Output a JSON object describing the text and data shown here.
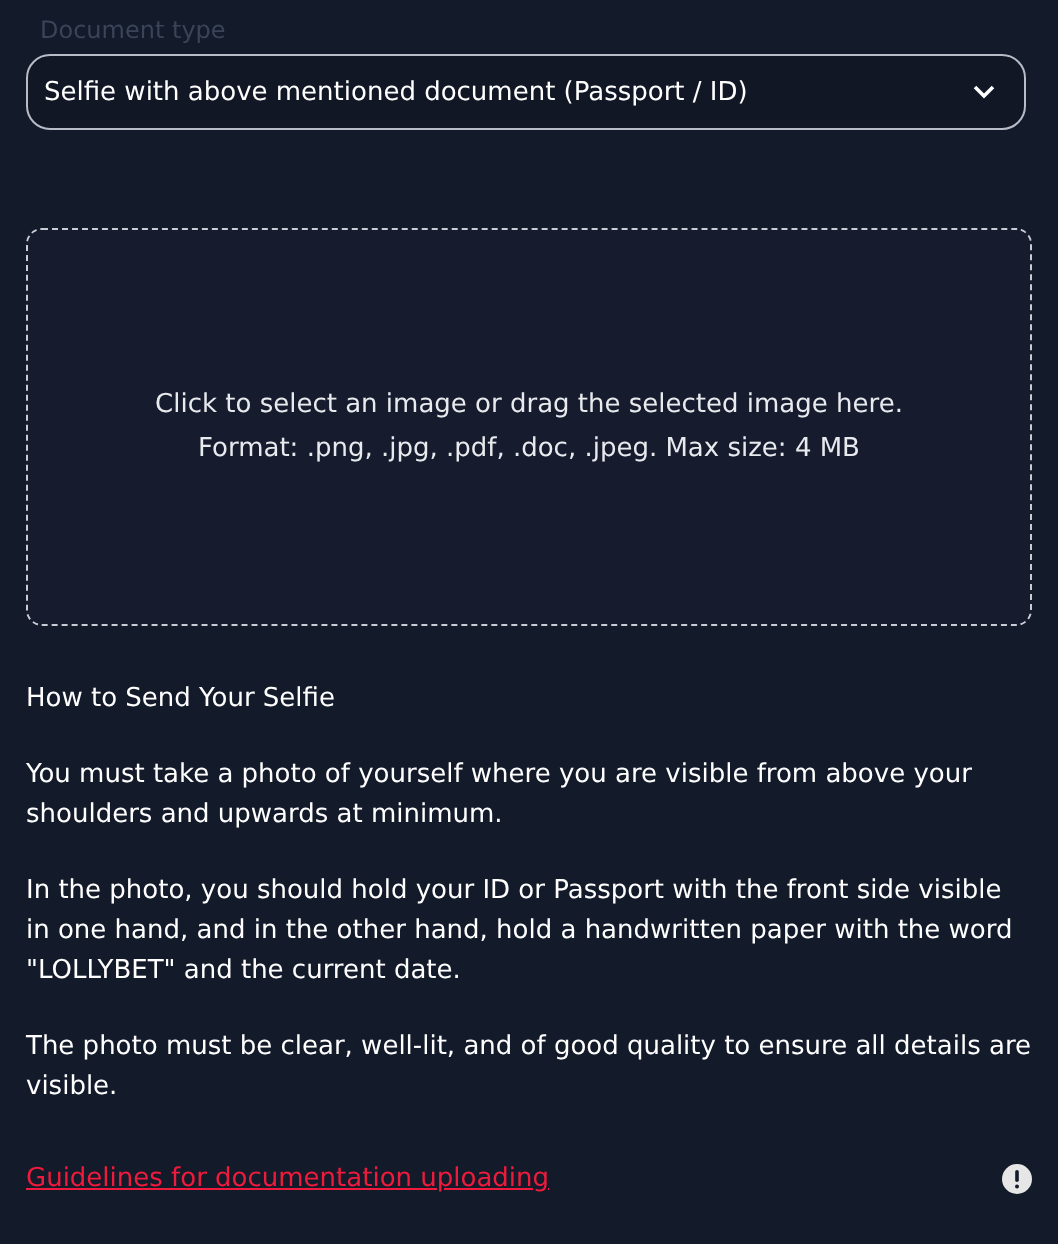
{
  "document_type": {
    "label": "Document type",
    "value": "Selfie with above mentioned document (Passport / ID)"
  },
  "dropzone": {
    "lines": [
      "Click to select an image or drag the selected image here.",
      "Format: .png, .jpg, .pdf, .doc, .jpeg. Max size: 4 MB"
    ]
  },
  "instructions": {
    "title": "How to Send Your Selfie",
    "paragraphs": [
      "You must take a photo of yourself where you are visible from above your shoulders and upwards at minimum.",
      "In the photo, you should hold your ID or Passport with the front side visible in one hand, and in the other hand, hold a handwritten paper with the word \"LOLLYBET\" and the current date.",
      "The photo must be clear, well-lit, and of good quality to ensure all details are visible."
    ]
  },
  "footer": {
    "link": "Guidelines for documentation uploading"
  }
}
